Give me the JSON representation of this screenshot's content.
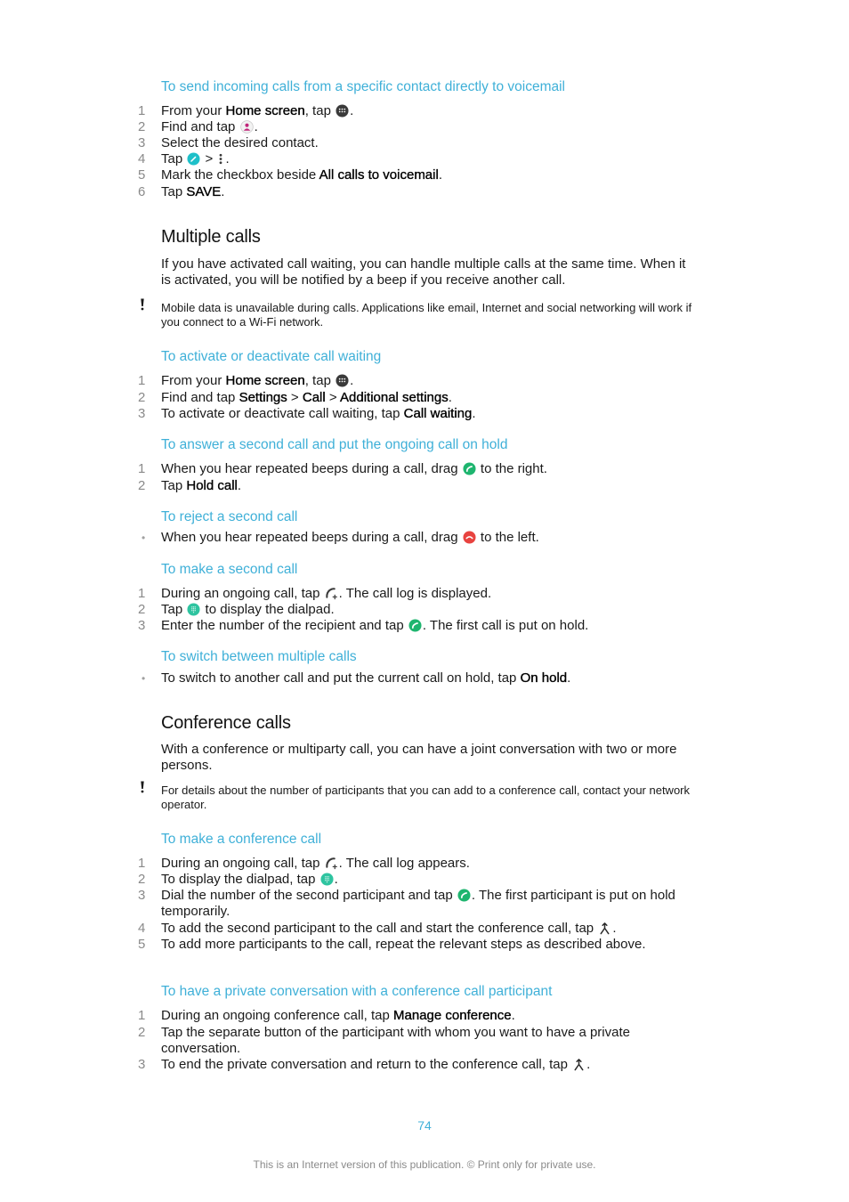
{
  "sections": {
    "voicemail": {
      "subheading": "To send incoming calls from a specific contact directly to voicemail",
      "steps": [
        {
          "num": "1",
          "a": "From your ",
          "b": "Home screen",
          "c": ", tap ",
          "d": "."
        },
        {
          "num": "2",
          "a": "Find and tap ",
          "d": "."
        },
        {
          "num": "3",
          "a": "Select the desired contact."
        },
        {
          "num": "4",
          "a": "Tap ",
          "sep": " > ",
          "d": "."
        },
        {
          "num": "5",
          "a": "Mark the checkbox beside ",
          "b": "All calls to voicemail",
          "d": "."
        },
        {
          "num": "6",
          "a": "Tap ",
          "b": "SAVE",
          "d": "."
        }
      ]
    },
    "multiple_calls": {
      "heading": "Multiple calls",
      "intro": "If you have activated call waiting, you can handle multiple calls at the same time. When it is activated, you will be notified by a beep if you receive another call.",
      "note": "Mobile data is unavailable during calls. Applications like email, Internet and social networking will work if you connect to a Wi-Fi network."
    },
    "call_waiting": {
      "subheading": "To activate or deactivate call waiting",
      "steps": [
        {
          "num": "1",
          "a": "From your ",
          "b": "Home screen",
          "c": ", tap ",
          "d": "."
        },
        {
          "num": "2",
          "a": "Find and tap ",
          "b1": "Settings",
          "s1": " > ",
          "b2": "Call",
          "s2": " > ",
          "b3": "Additional settings",
          "d": "."
        },
        {
          "num": "3",
          "a": "To activate or deactivate call waiting, tap ",
          "b": "Call waiting",
          "d": "."
        }
      ]
    },
    "answer_second": {
      "subheading": "To answer a second call and put the ongoing call on hold",
      "steps": [
        {
          "num": "1",
          "a": "When you hear repeated beeps during a call, drag ",
          "d": " to the right."
        },
        {
          "num": "2",
          "a": "Tap ",
          "b": "Hold call",
          "d": "."
        }
      ]
    },
    "reject_second": {
      "subheading": "To reject a second call",
      "bullets": [
        {
          "bullet": "•",
          "a": "When you hear repeated beeps during a call, drag ",
          "d": " to the left."
        }
      ]
    },
    "make_second": {
      "subheading": "To make a second call",
      "steps": [
        {
          "num": "1",
          "a": "During an ongoing call, tap ",
          "d": ". The call log is displayed."
        },
        {
          "num": "2",
          "a": "Tap ",
          "d": " to display the dialpad."
        },
        {
          "num": "3",
          "a": "Enter the number of the recipient and tap ",
          "d": ". The first call is put on hold."
        }
      ]
    },
    "switch_calls": {
      "subheading": "To switch between multiple calls",
      "bullets": [
        {
          "bullet": "•",
          "a": "To switch to another call and put the current call on hold, tap ",
          "b": "On hold",
          "d": "."
        }
      ]
    },
    "conference_calls": {
      "heading": "Conference calls",
      "intro": "With a conference or multiparty call, you can have a joint conversation with two or more persons.",
      "note": "For details about the number of participants that you can add to a conference call, contact your network operator."
    },
    "make_conference": {
      "subheading": "To make a conference call",
      "steps": [
        {
          "num": "1",
          "a": "During an ongoing call, tap ",
          "d": ". The call log appears."
        },
        {
          "num": "2",
          "a": "To display the dialpad, tap ",
          "d": "."
        },
        {
          "num": "3",
          "a": "Dial the number of the second participant and tap ",
          "d": ". The first participant is put on hold temporarily."
        },
        {
          "num": "4",
          "a": "To add the second participant to the call and start the conference call, tap ",
          "d": "."
        },
        {
          "num": "5",
          "a": "To add more participants to the call, repeat the relevant steps as described above."
        }
      ]
    },
    "private_conversation": {
      "subheading": "To have a private conversation with a conference call participant",
      "steps": [
        {
          "num": "1",
          "a": "During an ongoing conference call, tap ",
          "b": "Manage conference",
          "d": "."
        },
        {
          "num": "2",
          "a": "Tap the separate button of the participant with whom you want to have a private conversation."
        },
        {
          "num": "3",
          "a": "To end the private conversation and return to the conference call, tap ",
          "d": "."
        }
      ]
    }
  },
  "icons": {
    "apps": "apps-grid-icon",
    "contacts": "contacts-icon",
    "edit": "edit-pencil-icon",
    "more": "more-vertical-icon",
    "answer": "answer-call-icon",
    "reject": "reject-call-icon",
    "add_call": "add-call-icon",
    "dialpad": "dialpad-icon",
    "call": "call-icon",
    "merge": "merge-calls-icon",
    "note": "exclamation-icon"
  },
  "colors": {
    "accent": "#3fb0d8",
    "call_green": "#1eb56f",
    "reject_red": "#e8433f",
    "edit_teal": "#1ec0c9",
    "dialpad_teal": "#2ec4a0",
    "contacts_pink": "#c0267a"
  },
  "page": {
    "number": "74",
    "footer": "This is an Internet version of this publication. © Print only for private use."
  }
}
